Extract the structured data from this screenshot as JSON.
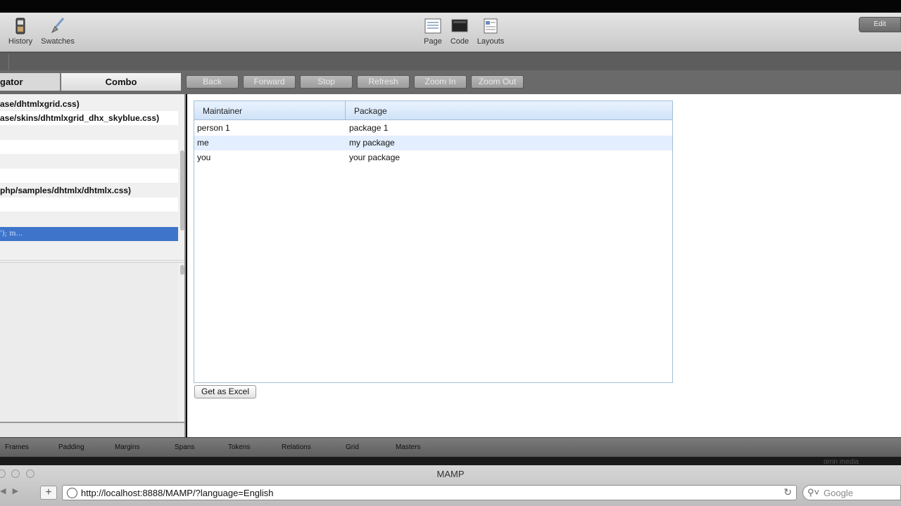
{
  "toolbar": {
    "left_buttons": [
      {
        "label": "History",
        "icon": "history-icon"
      },
      {
        "label": "Swatches",
        "icon": "swatches-brush-icon"
      }
    ],
    "center_buttons": [
      {
        "label": "Page",
        "icon": "page-icon"
      },
      {
        "label": "Code",
        "icon": "code-terminal-icon"
      },
      {
        "label": "Layouts",
        "icon": "layouts-icon"
      }
    ],
    "edit_label": "Edit"
  },
  "panel_tabs": {
    "navigator": "gator",
    "combo": "Combo"
  },
  "nav_buttons": [
    "Back",
    "Forward",
    "Stop",
    "Refresh",
    "Zoom In",
    "Zoom Out"
  ],
  "css_list": [
    "ase/dhtmlxgrid.css)",
    "ase/skins/dhtmlxgrid_dhx_skyblue.css)",
    "",
    "",
    "",
    "",
    "php/samples/dhtmlx/dhtmlx.css)",
    "",
    "",
    "');                 m..."
  ],
  "grid": {
    "headers": [
      "Maintainer",
      "Package"
    ],
    "rows": [
      [
        "person 1",
        "package 1"
      ],
      [
        "me",
        "my package"
      ],
      [
        "you",
        "your package"
      ]
    ]
  },
  "excel_button": "Get as Excel",
  "guides": [
    "Frames",
    "Padding",
    "Margins",
    "Spans",
    "Tokens",
    "Relations",
    "Grid",
    "Masters"
  ],
  "brand_text": "orrin media",
  "browser": {
    "title": "MAMP",
    "url": "http://localhost:8888/MAMP/?language=English",
    "search_placeholder": "Google"
  }
}
